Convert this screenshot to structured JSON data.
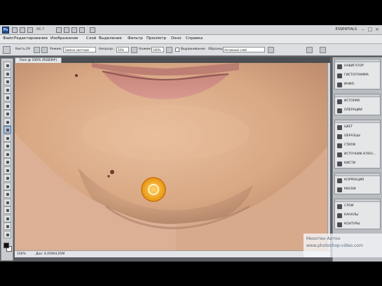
{
  "app": {
    "logo": "Ps",
    "zoom_value": "66.7",
    "workspace_label": "ESSENTIALS",
    "menu": [
      "Файл",
      "Редактирование",
      "Изображение",
      "Слой",
      "Выделение",
      "Фильтр",
      "Просмотр",
      "Окно",
      "Справка"
    ]
  },
  "options_bar": {
    "brush_label": "Кисть:",
    "brush_size": "19",
    "mode_label": "Режим:",
    "mode_value": "Замена светлым",
    "opacity_label": "Непрозр.:",
    "opacity_value": "50%",
    "flow_label": "Нажим:",
    "flow_value": "100%",
    "aligned_label": "Выравнивание",
    "sample_label": "Образец:",
    "sample_value": "Активный слой"
  },
  "document": {
    "tab_title": "Face @ 100% (RGB/8#)",
    "status_zoom": "100%",
    "status_info": "Док: 4,05М/4,05М"
  },
  "panels": {
    "groups": [
      {
        "items": [
          "НАВИГАТОР",
          "ГИСТОГРАММА",
          "ИНФО"
        ]
      },
      {
        "items": [
          "ИСТОРИЯ",
          "ОПЕРАЦИИ"
        ]
      },
      {
        "items": [
          "ЦВЕТ",
          "ОБРАЗЦЫ",
          "СТИЛИ",
          "ИСТОЧНИК КЛОН...",
          "КИСТИ"
        ]
      },
      {
        "items": [
          "КОРРЕКЦИЯ",
          "МАСКИ"
        ]
      },
      {
        "items": [
          "СЛОИ",
          "КАНАЛЫ",
          "КОНТУРЫ"
        ]
      }
    ]
  },
  "watermark": {
    "author": "Михотин Антон",
    "url": "www.photoshop-video.com"
  },
  "colors": {
    "accent": "#1e4f8f",
    "brush_cursor": "#f5b021",
    "panel_bg": "#e4e6e8"
  },
  "icons": {
    "tools": [
      "move-icon",
      "marquee-icon",
      "lasso-icon",
      "magic-wand-icon",
      "crop-icon",
      "eyedropper-icon",
      "healing-icon",
      "brush-icon",
      "clone-stamp-icon",
      "history-brush-icon",
      "eraser-icon",
      "gradient-icon",
      "blur-icon",
      "dodge-icon",
      "pen-icon",
      "type-icon",
      "path-select-icon",
      "shape-icon",
      "3d-rotate-icon",
      "3d-orbit-icon",
      "hand-icon",
      "zoom-icon"
    ]
  }
}
